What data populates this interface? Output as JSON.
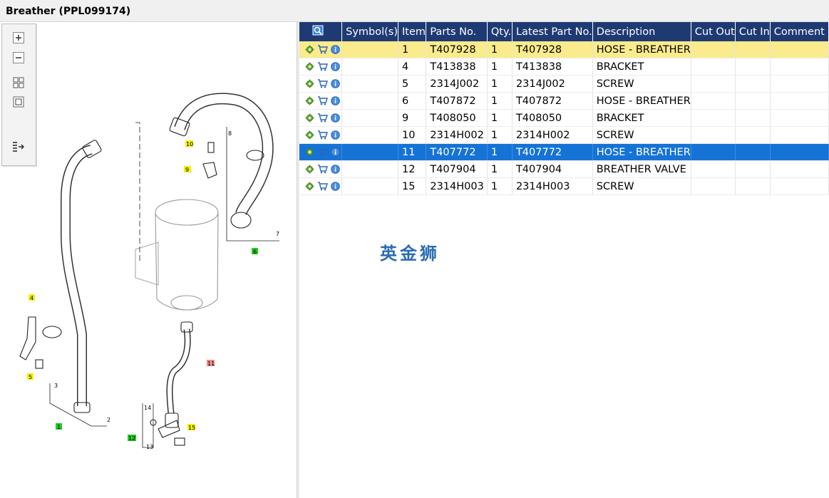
{
  "window": {
    "title": "Breather (PPL099174)"
  },
  "toolbox": {
    "buttons": [
      "zoom-in",
      "zoom-out",
      "fit-all",
      "fit-page",
      "export"
    ]
  },
  "diagram": {
    "callouts": [
      "10",
      "9",
      "8",
      "7",
      "6",
      "4",
      "5",
      "3",
      "2",
      "1",
      "11",
      "14",
      "12",
      "15",
      "13"
    ]
  },
  "table": {
    "columns": [
      "",
      "Symbol(s)",
      "Item",
      "Parts No.",
      "Qty.",
      "Latest Part No.",
      "Description",
      "Cut Out",
      "Cut In",
      "Comment"
    ],
    "rows": [
      {
        "item": "1",
        "part": "T407928",
        "qty": "1",
        "latest": "T407928",
        "desc": "HOSE - BREATHER",
        "state": "highlight"
      },
      {
        "item": "4",
        "part": "T413838",
        "qty": "1",
        "latest": "T413838",
        "desc": "BRACKET",
        "state": "normal"
      },
      {
        "item": "5",
        "part": "2314J002",
        "qty": "1",
        "latest": "2314J002",
        "desc": "SCREW",
        "state": "normal"
      },
      {
        "item": "6",
        "part": "T407872",
        "qty": "1",
        "latest": "T407872",
        "desc": "HOSE - BREATHER",
        "state": "normal"
      },
      {
        "item": "9",
        "part": "T408050",
        "qty": "1",
        "latest": "T408050",
        "desc": "BRACKET",
        "state": "normal"
      },
      {
        "item": "10",
        "part": "2314H002",
        "qty": "1",
        "latest": "2314H002",
        "desc": "SCREW",
        "state": "normal"
      },
      {
        "item": "11",
        "part": "T407772",
        "qty": "1",
        "latest": "T407772",
        "desc": "HOSE - BREATHER",
        "state": "selected"
      },
      {
        "item": "12",
        "part": "T407904",
        "qty": "1",
        "latest": "T407904",
        "desc": "BREATHER VALVE",
        "state": "normal"
      },
      {
        "item": "15",
        "part": "2314H003",
        "qty": "1",
        "latest": "2314H003",
        "desc": "SCREW",
        "state": "normal"
      }
    ]
  },
  "watermark": "英金狮",
  "colors": {
    "header": "#1f3a73",
    "highlight_row": "#faeb8c",
    "selected_row": "#1573d6",
    "callout_yellow": "#f5f000",
    "callout_green": "#22cc22",
    "callout_red": "#f08a8a"
  }
}
